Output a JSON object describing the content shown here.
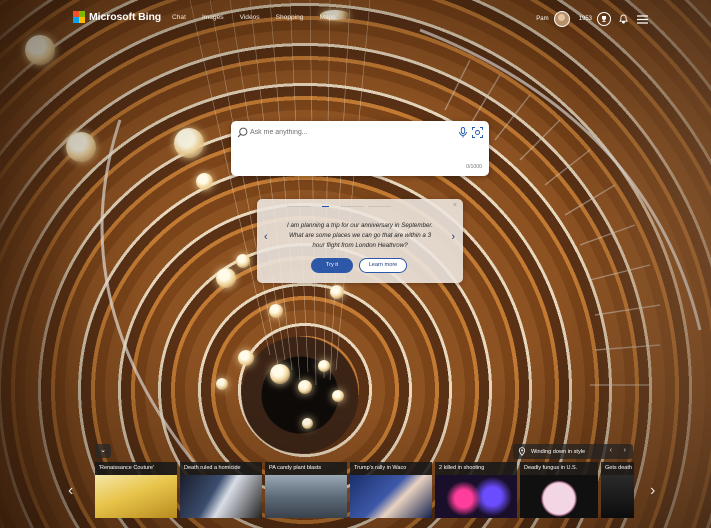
{
  "header": {
    "brand": "Microsoft Bing",
    "nav": [
      "Chat",
      "Images",
      "Videos",
      "Shopping",
      "Maps"
    ],
    "user_name": "Pam",
    "reward_points": "1953"
  },
  "search": {
    "placeholder": "Ask me anything...",
    "char_count": "0/1000"
  },
  "suggestion": {
    "text": "I am planning a trip for our anniversary in September. What are some places we can go that are within a 3 hour flight from London Heathrow?",
    "try_label": "Try it",
    "learn_label": "Learn more",
    "close_glyph": "×",
    "prev_glyph": "‹",
    "next_glyph": "›"
  },
  "image_info": {
    "title": "Winding down in style"
  },
  "feed": {
    "collapse_glyph": "⌄",
    "prev_glyph": "‹",
    "next_glyph": "›",
    "items": [
      "'Renaissance Couture'",
      "Death ruled a homicide",
      "PA candy plant blasts",
      "Trump's rally in Waco",
      "2 killed in shooting",
      "Deadly fungus in U.S.",
      "Gets death"
    ]
  },
  "colors": {
    "accent": "#2d58a7",
    "logo": [
      "#f25022",
      "#7fba00",
      "#00a4ef",
      "#ffb900"
    ]
  }
}
